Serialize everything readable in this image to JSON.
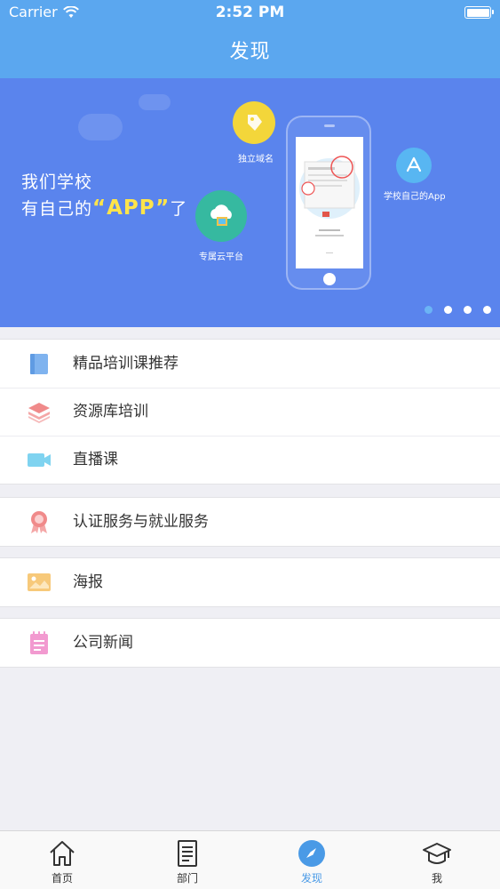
{
  "status_bar": {
    "carrier": "Carrier",
    "time": "2:52 PM"
  },
  "nav": {
    "title": "发现"
  },
  "banner": {
    "line1": "我们学校",
    "line2_prefix": "有自己的",
    "line2_highlight": "“APP”",
    "line2_suffix": "了",
    "badges": {
      "domain": "独立域名",
      "cloud": "专属云平台",
      "app": "学校自己的App"
    },
    "page_count": 4,
    "active_page": 1
  },
  "menu": {
    "group1": [
      {
        "label": "精品培训课推荐",
        "icon": "book-icon",
        "color": "#7fb3ef"
      },
      {
        "label": "资源库培训",
        "icon": "layers-icon",
        "color": "#f08a8a"
      },
      {
        "label": "直播课",
        "icon": "video-camera-icon",
        "color": "#7fd3f0"
      }
    ],
    "group2": [
      {
        "label": "认证服务与就业服务",
        "icon": "award-ribbon-icon",
        "color": "#f0a0a0"
      }
    ],
    "group3": [
      {
        "label": "海报",
        "icon": "picture-icon",
        "color": "#f7c97a"
      }
    ],
    "group4": [
      {
        "label": "公司新闻",
        "icon": "notepad-icon",
        "color": "#f29ad0"
      }
    ]
  },
  "tabbar": {
    "tabs": [
      {
        "label": "首页",
        "icon": "home-icon"
      },
      {
        "label": "部门",
        "icon": "document-list-icon"
      },
      {
        "label": "发现",
        "icon": "compass-icon",
        "active": true
      },
      {
        "label": "我",
        "icon": "graduation-cap-icon"
      }
    ],
    "active_color": "#4a9ae6"
  },
  "colors": {
    "header": "#5ba7ef",
    "banner": "#5a84ed",
    "background": "#efeff4"
  }
}
